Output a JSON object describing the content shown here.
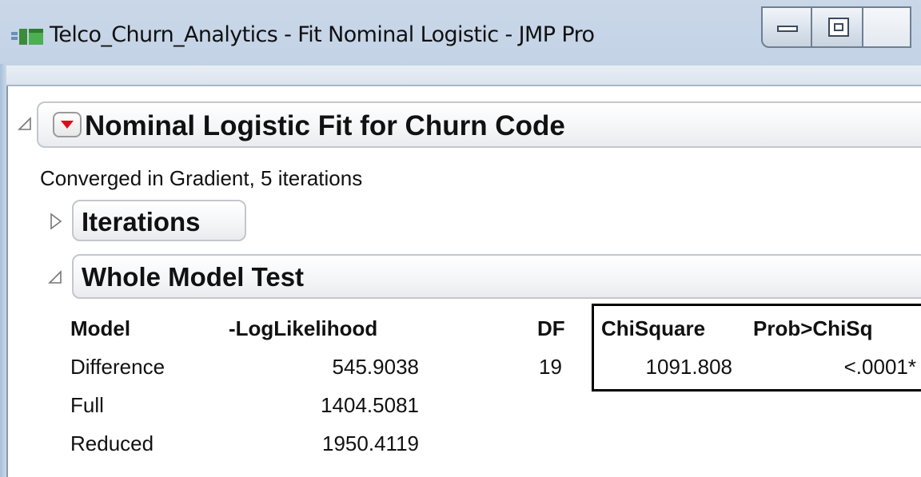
{
  "window": {
    "title": "Telco_Churn_Analytics - Fit Nominal Logistic - JMP Pro",
    "app_icon": "jmp-data-table-icon",
    "controls": [
      "minimize-icon",
      "restore-icon",
      "close-icon"
    ]
  },
  "report": {
    "main_header": "Nominal Logistic Fit for Churn Code",
    "status": "Converged in Gradient, 5 iterations",
    "iterations_header": "Iterations",
    "iterations_collapsed": true,
    "whole_model_test_header": "Whole Model Test",
    "whole_model_test_expanded": true,
    "columns": [
      "Model",
      "-LogLikelihood",
      "DF",
      "ChiSquare",
      "Prob>ChiSq"
    ],
    "rows": [
      {
        "model": "Difference",
        "loglik": "545.9038",
        "df": "19",
        "chisq": "1091.808",
        "prob": "<.0001*"
      },
      {
        "model": "Full",
        "loglik": "1404.5081",
        "df": "",
        "chisq": "",
        "prob": ""
      },
      {
        "model": "Reduced",
        "loglik": "1950.4119",
        "df": "",
        "chisq": "",
        "prob": ""
      }
    ]
  },
  "colors": {
    "red_triangle": "#d4121c",
    "highlight_box": "#000000"
  }
}
